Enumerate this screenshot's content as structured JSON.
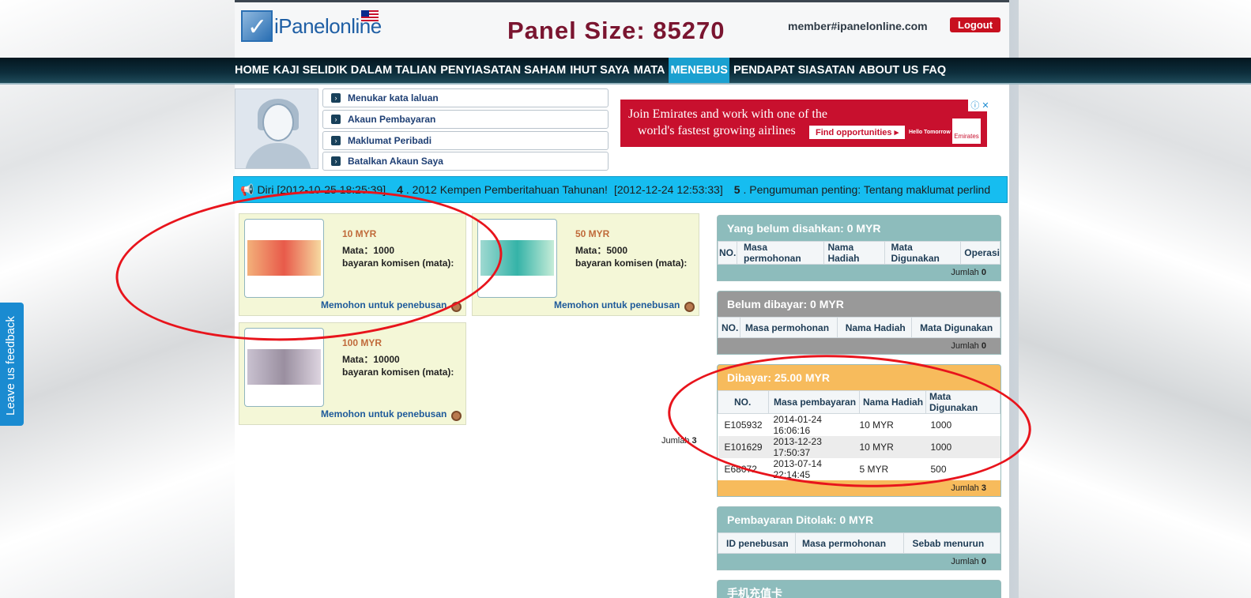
{
  "header": {
    "brand": "iPanelonline",
    "panel_size": "Panel Size: 85270",
    "member_email": "member#ipanelonline.com",
    "logout_label": "Logout"
  },
  "nav": {
    "items": [
      "HOME",
      "KAJI SELIDIK DALAM TALIAN",
      "PENYIASATAN SAHAM",
      "IHUT SAYA",
      "MATA",
      "MENEBUS",
      "PENDAPAT SIASATAN",
      "ABOUT US",
      "FAQ"
    ],
    "active": "MENEBUS"
  },
  "account_menu": {
    "items": [
      "Menukar kata laluan",
      "Akaun Pembayaran",
      "Maklumat Peribadi",
      "Batalkan Akaun Saya"
    ]
  },
  "ad": {
    "line1": "Join Emirates and work with one of the",
    "line2": "world's fastest growing airlines",
    "cta": "Find opportunities ▸",
    "tagline": "Hello Tomorrow",
    "brand": "Emirates"
  },
  "ticker": {
    "lead": "Diri",
    "lead_time": "[2012-10-25 18:25:39]",
    "item4_num": "4",
    "item4_text": ". 2012 Kempen Pemberitahuan Tahunan!",
    "item4_time": "[2012-12-24 12:53:33]",
    "item5_num": "5",
    "item5_text": ". Pengumuman penting: Tentang maklumat perlind"
  },
  "redeem_cards": [
    {
      "amount": "10 MYR",
      "mata": "Mata：1000",
      "komisen": "bayaran komisen (mata):",
      "action": "Memohon untuk penebusan",
      "note_color": "#e85a4a"
    },
    {
      "amount": "50 MYR",
      "mata": "Mata：5000",
      "komisen": "bayaran komisen (mata):",
      "action": "Memohon untuk penebusan",
      "note_color": "#35b3a8"
    },
    {
      "amount": "100 MYR",
      "mata": "Mata：10000",
      "komisen": "bayaran komisen (mata):",
      "action": "Memohon untuk penebusan",
      "note_color": "#9a8fa0"
    }
  ],
  "jumlah_left": {
    "label": "Jumlah",
    "value": "3"
  },
  "side": {
    "pending": {
      "title": "Yang belum disahkan: 0 MYR",
      "cols": [
        "NO.",
        "Masa permohonan",
        "Nama Hadiah",
        "Mata Digunakan",
        "Operasi"
      ],
      "foot_label": "Jumlah",
      "foot_value": "0"
    },
    "unpaid": {
      "title": "Belum dibayar: 0 MYR",
      "cols": [
        "NO.",
        "Masa permohonan",
        "Nama Hadiah",
        "Mata Digunakan"
      ],
      "foot_label": "Jumlah",
      "foot_value": "0"
    },
    "paid": {
      "title": "Dibayar: 25.00 MYR",
      "cols": [
        "NO.",
        "Masa pembayaran",
        "Nama Hadiah",
        "Mata Digunakan"
      ],
      "rows": [
        {
          "no": "E105932",
          "time": "2014-01-24 16:06:16",
          "gift": "10 MYR",
          "mata": "1000"
        },
        {
          "no": "E101629",
          "time": "2013-12-23 17:50:37",
          "gift": "10 MYR",
          "mata": "1000"
        },
        {
          "no": "E68072",
          "time": "2013-07-14 22:14:45",
          "gift": "5 MYR",
          "mata": "500"
        }
      ],
      "foot_label": "Jumlah",
      "foot_value": "3"
    },
    "rejected": {
      "title": "Pembayaran Ditolak: 0 MYR",
      "cols": [
        "ID penebusan",
        "Masa permohonan",
        "Sebab menurun"
      ],
      "foot_label": "Jumlah",
      "foot_value": "0"
    },
    "mobile": {
      "title": "手机充值卡"
    }
  },
  "feedback_tab": "Leave us feedback",
  "colors": {
    "nav_active": "#1aa0d0",
    "ticker_bg": "#16bdf0",
    "logout": "#c8101f",
    "annotation": "#e8141c"
  }
}
